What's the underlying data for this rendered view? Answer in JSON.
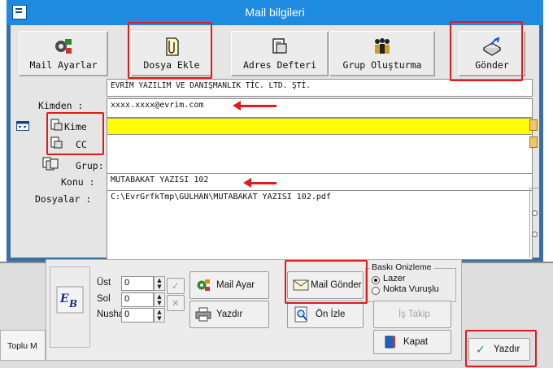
{
  "window": {
    "title": "Mail bilgileri"
  },
  "toolbar": {
    "mail_settings": "Mail Ayarlar",
    "attach_file": "Dosya Ekle",
    "address_book": "Adres Defteri",
    "create_group": "Grup Oluşturma",
    "send": "Gönder"
  },
  "form": {
    "company": "EVRİM YAZILIM VE DANIŞMANLIK TİC. LTD. ŞTİ.",
    "from_label": "Kimden :",
    "from_value": "xxxx.xxxx@evrim.com",
    "to_label": "Kime",
    "to_value": "",
    "cc_label": "CC",
    "cc_value": "",
    "group_label": "Grup:",
    "subject_label": "Konu :",
    "subject_value": "MUTABAKAT YAZISI 102",
    "files_label": "Dosyalar :",
    "files_value": "C:\\EvrGrfkTmp\\GULHAN\\MUTABAKAT YAZISI 102.pdf"
  },
  "print_panel": {
    "top_label": "Üst",
    "top_value": "0",
    "left_label": "Sol",
    "left_value": "0",
    "copies_label": "Nusha",
    "copies_value": "0",
    "mail_settings": "Mail Ayar",
    "mail_send": "Mail Gönder",
    "print": "Yazdır",
    "preview": "Ön İzle",
    "job_tracking": "İş Takip",
    "close": "Kapat",
    "preview_group_title": "Baskı Onizleme",
    "laser": "Lazer",
    "dot_matrix": "Nokta Vuruşlu"
  },
  "taskbar": {
    "left_item": "Toplu M"
  },
  "footer": {
    "print": "Yazdır"
  },
  "colors": {
    "titlebar": "#1f8be0",
    "highlight_field": "#ffff00",
    "annotation_red": "#e01b1b",
    "frame": "#3a6fa4"
  }
}
